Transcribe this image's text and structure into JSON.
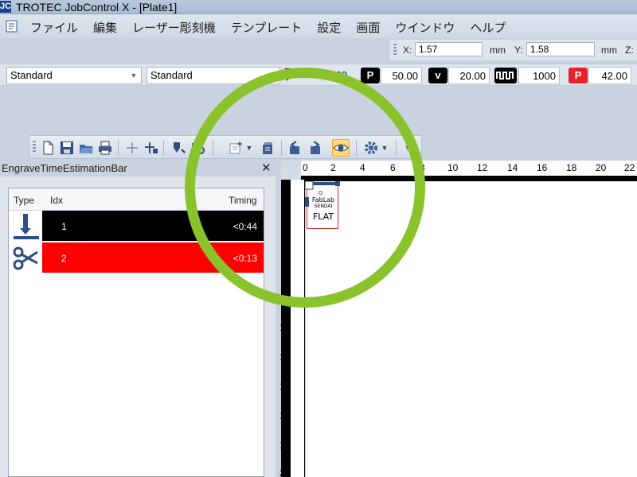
{
  "window": {
    "app_icon": "JC",
    "title": "TROTEC JobControl X - [Plate1]"
  },
  "menu": {
    "items": [
      "ファイル",
      "編集",
      "レーザー彫刻機",
      "テンプレート",
      "設定",
      "画面",
      "ウインドウ",
      "ヘルプ"
    ]
  },
  "coordinates": {
    "x_label": "X:",
    "x_value": "1.57",
    "x_unit": "mm",
    "y_label": "Y:",
    "y_value": "1.58",
    "y_unit": "mm",
    "z_label": "Z:"
  },
  "parameters": {
    "material_combo": "Standard",
    "process_combo": "Standard",
    "thickness_value": "5.00",
    "power_badge": "P",
    "power_value": "50.00",
    "velocity_badge": "v",
    "velocity_value": "20.00",
    "frequency_value": "1000",
    "red_power_badge": "P",
    "red_power_value": "42.00",
    "colors": {
      "active_red": "#e8202a",
      "badge_black": "#000000"
    }
  },
  "toolbar": {
    "icons": [
      "new-file-icon",
      "save-icon",
      "open-folder-icon",
      "print-icon",
      "crosshair-icon",
      "add-marker-icon",
      "laser-head-icon",
      "laser-process-icon",
      "add-job-icon",
      "queue-icon",
      "import-icon",
      "export-icon",
      "preview-eye-icon",
      "settings-gear-icon",
      "toolbar-options-icon"
    ]
  },
  "engrave_panel": {
    "title": "EngraveTimeEstimationBar",
    "close": "✕",
    "headers": {
      "type": "Type",
      "idx": "Idx",
      "timing": "Timing"
    },
    "rows": [
      {
        "idx": "1",
        "timing": "<0:44",
        "type": "engrave",
        "color": "#000000"
      },
      {
        "idx": "2",
        "timing": "<0:13",
        "type": "cut",
        "color": "#ff0000"
      }
    ]
  },
  "ruler": {
    "h_ticks": [
      "0",
      "2",
      "4",
      "6",
      "8",
      "10",
      "12",
      "14",
      "16",
      "18",
      "20",
      "22"
    ],
    "v_ticks": [
      "2",
      "4",
      "6",
      "8",
      "10",
      "12",
      "14",
      "16",
      "18",
      "20"
    ]
  },
  "design": {
    "line1": "FabLab",
    "line2": "SENDAI",
    "line3": "FLAT"
  },
  "highlight_color": "#8ac22c"
}
